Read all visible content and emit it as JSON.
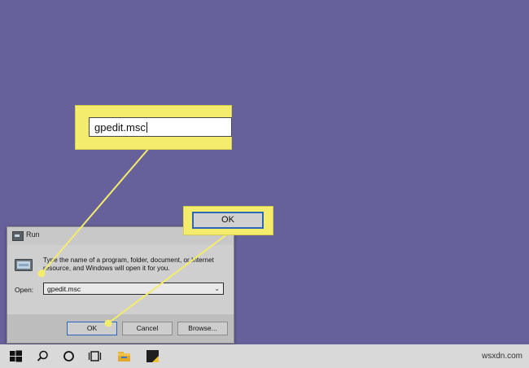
{
  "dialog": {
    "title": "Run",
    "description": "Type the name of a program, folder, document, or Internet resource, and Windows will open it for you.",
    "open_label": "Open:",
    "open_value": "gpedit.msc",
    "buttons": {
      "ok": "OK",
      "cancel": "Cancel",
      "browse": "Browse..."
    }
  },
  "callouts": {
    "input_text": "gpedit.msc",
    "ok_label": "OK"
  },
  "taskbar": {
    "icons": [
      "windows-start-icon",
      "search-icon",
      "cortana-icon",
      "task-view-icon",
      "file-explorer-icon",
      "sticky-notes-icon"
    ]
  },
  "watermark": "wsxdn.com",
  "colors": {
    "desktop": "#66619a",
    "callout": "#f4ec6c",
    "accent": "#2b66b9"
  }
}
